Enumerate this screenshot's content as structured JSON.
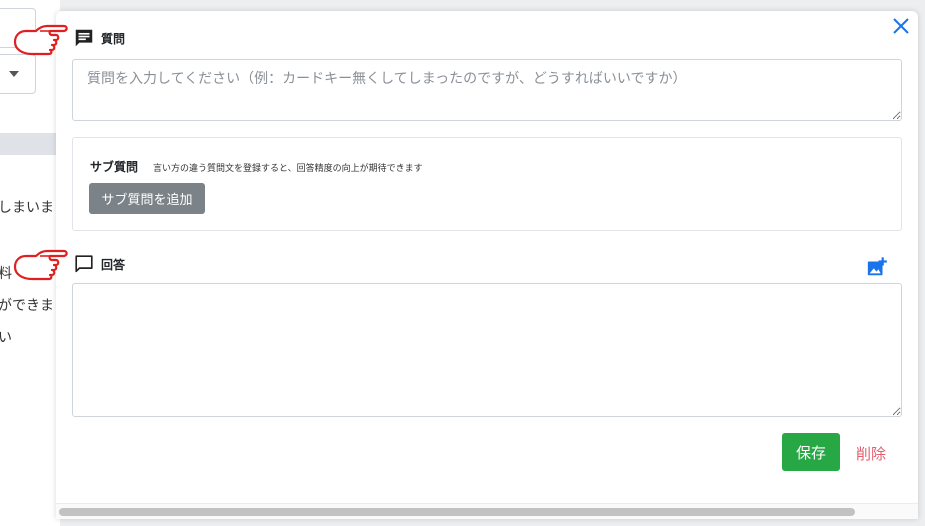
{
  "background": {
    "lines": [
      "しまいまし",
      "料",
      "ができま",
      "い"
    ]
  },
  "modal": {
    "close_icon": "close-icon",
    "question": {
      "heading": "質問",
      "icon": "chat-filled-icon",
      "placeholder": "質問を入力してください（例：カードキー無くしてしまったのですが、どうすればいいですか）",
      "value": ""
    },
    "sub_question": {
      "title": "サブ質問",
      "description": "言い方の違う質問文を登録すると、回答精度の向上が期待できます",
      "add_button": "サブ質問を追加"
    },
    "answer": {
      "heading": "回答",
      "icon": "chat-outline-icon",
      "value": "",
      "add_image_icon": "add-image-icon"
    },
    "save_button": "保存",
    "delete_button": "削除"
  },
  "colors": {
    "accent_blue": "#1a73e8",
    "save_green": "#28a745",
    "delete_red": "#e4606d",
    "secondary_gray": "#7b8288",
    "hand_red": "#e02020"
  }
}
